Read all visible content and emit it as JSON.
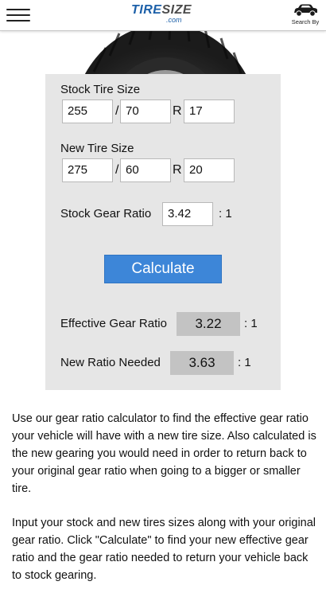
{
  "header": {
    "logo_main_a": "TIRE",
    "logo_main_b": "SIZE",
    "logo_sub": ".com",
    "search_by_label": "Search By"
  },
  "calculator": {
    "stock_tire": {
      "label": "Stock Tire Size",
      "width": "255",
      "aspect": "70",
      "rim": "17",
      "slash": "/",
      "r": "R"
    },
    "new_tire": {
      "label": "New Tire Size",
      "width": "275",
      "aspect": "60",
      "rim": "20",
      "slash": "/",
      "r": "R"
    },
    "stock_gear_ratio": {
      "label": "Stock Gear Ratio",
      "value": "3.42",
      "suffix": ": 1"
    },
    "calculate_label": "Calculate",
    "effective_gear_ratio": {
      "label": "Effective Gear Ratio",
      "value": "3.22",
      "suffix": ": 1"
    },
    "new_ratio_needed": {
      "label": "New Ratio Needed",
      "value": "3.63",
      "suffix": ": 1"
    }
  },
  "description": {
    "para1": "Use our gear ratio calculator to find the effective gear ratio your vehicle will have with a new tire size. Also calculated is the new gearing you would need in order to return back to your original gear ratio when going to a bigger or smaller tire.",
    "para2": "Input your stock and new tires sizes along with your original gear ratio. Click \"Calculate\" to find your new effective gear ratio and the gear ratio needed to return your vehicle back to stock gearing."
  },
  "colors": {
    "button_blue": "#3d86d8",
    "panel_gray": "#e6e6e6",
    "result_gray": "#c3c3c3",
    "logo_blue": "#1b5fa8"
  },
  "icons": {
    "menu": "hamburger-menu-icon",
    "search_by": "car-icon"
  }
}
